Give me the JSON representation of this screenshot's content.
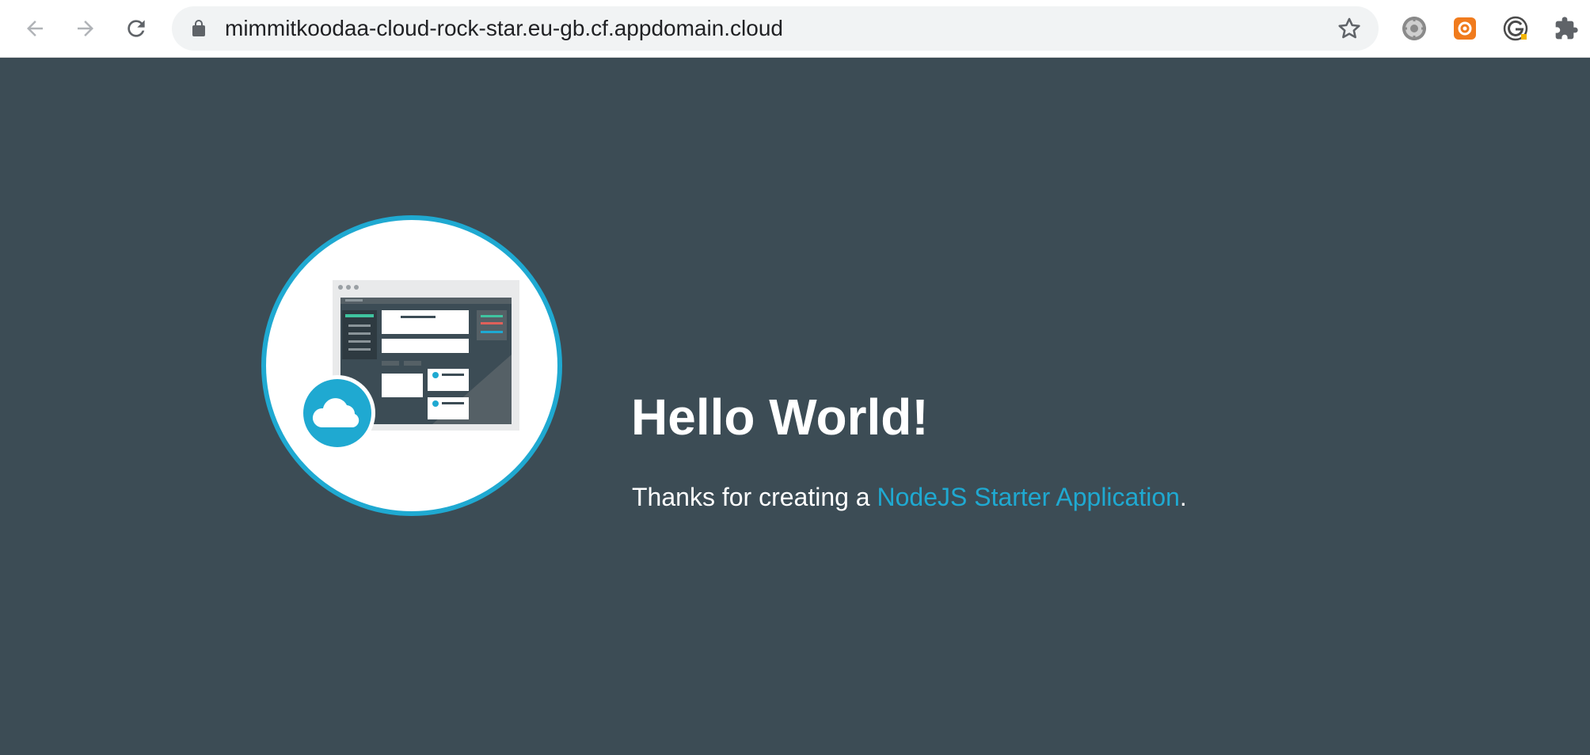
{
  "browser": {
    "url": "mimmitkoodaa-cloud-rock-star.eu-gb.cf.appdomain.cloud",
    "icons": {
      "back": "arrow-left-icon",
      "forward": "arrow-right-icon",
      "reload": "reload-icon",
      "lock": "lock-icon",
      "bookmark": "star-icon",
      "extensions": [
        "gear-extension-icon",
        "orange-extension-icon",
        "g-extension-icon",
        "puzzle-icon"
      ]
    }
  },
  "page": {
    "heading": "Hello World!",
    "message_prefix": "Thanks for creating a ",
    "link_text": "NodeJS Starter Application",
    "message_suffix": ".",
    "colors": {
      "background": "#3c4c55",
      "accent": "#1fa9d1",
      "text": "#ffffff"
    }
  }
}
